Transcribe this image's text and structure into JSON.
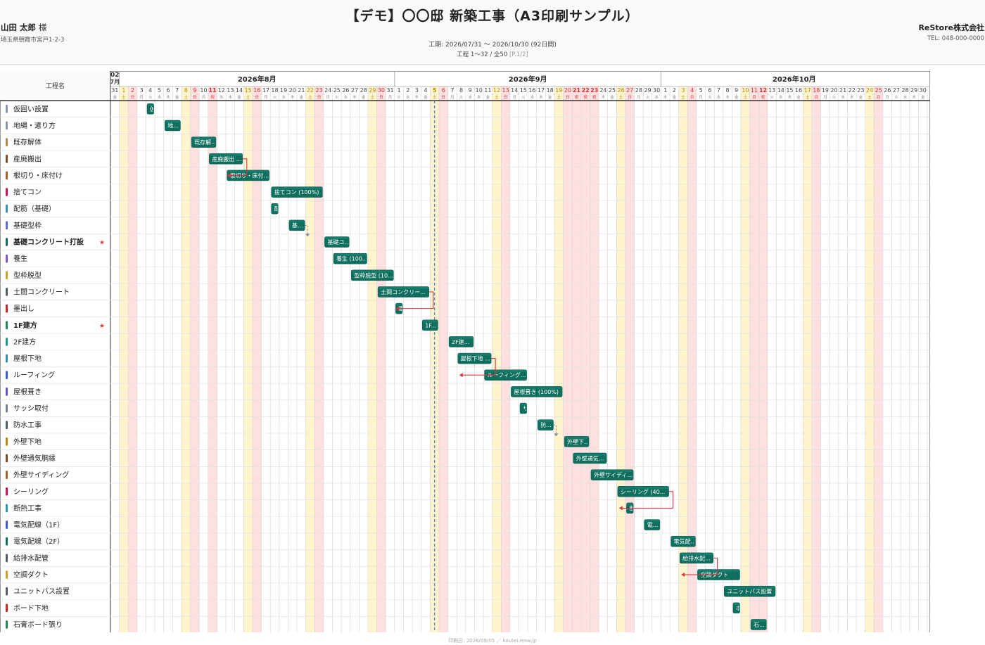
{
  "header": {
    "title": "【デモ】〇〇邸 新築工事（A3印刷サンプル）",
    "client_name": "山田 太郎",
    "client_suffix": "様",
    "client_address": "埼玉県朝霞市宮戸1-2-3",
    "company": "ReStore株式会社",
    "tel": "TEL: 048-000-0000",
    "period": "工期: 2026/07/31 〜 2026/10/30 (92日間)",
    "range": "工程 1〜32 / 全50",
    "page": "[P.1/2]"
  },
  "gantt": {
    "column_header": "工程名",
    "start_date": "2026-07-31",
    "days": 92,
    "today": "2026-09-05",
    "colors": {
      "bar": "#0f6e5e",
      "bar_light": "#1c8a77",
      "saturday": "#fff4cc",
      "holiday": "#ffe0e0",
      "today": "#4a7fd9",
      "link": "#d9363e"
    },
    "months": [
      {
        "label": "2026年8月"
      },
      {
        "label": "2026年9月"
      },
      {
        "label": "2026年10月"
      }
    ],
    "partial_month_label": "2026年7月",
    "holidays": [
      "2026-08-11",
      "2026-09-21",
      "2026-09-22",
      "2026-09-23",
      "2026-10-12"
    ],
    "weekday_labels": [
      "日",
      "月",
      "火",
      "水",
      "木",
      "金",
      "土"
    ],
    "tasks": [
      {
        "name": "仮囲い設置",
        "color": "#8a94a6",
        "bar": "仮",
        "start": 4,
        "dur": 1
      },
      {
        "name": "地縄・遣り方",
        "color": "#8a94a6",
        "bar": "地...",
        "start": 6,
        "dur": 2
      },
      {
        "name": "既存解体",
        "color": "#b08a4a",
        "bar": "既存解...",
        "start": 9,
        "dur": 3
      },
      {
        "name": "産廃搬出",
        "color": "#7a4a2a",
        "bar": "産廃搬出 ...",
        "start": 11,
        "dur": 4
      },
      {
        "name": "根切り・床付け",
        "color": "#a0602a",
        "bar": "根切り・床付...",
        "start": 13,
        "dur": 5
      },
      {
        "name": "捨てコン",
        "color": "#c2185b",
        "bar": "捨てコン (100%)",
        "start": 18,
        "dur": 6
      },
      {
        "name": "配筋（基礎）",
        "color": "#3a8fb7",
        "bar": "配",
        "start": 18,
        "dur": 1
      },
      {
        "name": "基礎型枠",
        "color": "#5b6bd6",
        "bar": "基...",
        "start": 20,
        "dur": 2
      },
      {
        "name": "基礎コンクリート打設",
        "color": "#0f6e5e",
        "bar": "基礎コ...",
        "start": 24,
        "dur": 3,
        "bold": true,
        "star": true
      },
      {
        "name": "養生",
        "color": "#7e57c2",
        "bar": "養生 (100...",
        "start": 25,
        "dur": 4
      },
      {
        "name": "型枠脱型",
        "color": "#c9a227",
        "bar": "型枠脱型 (10...",
        "start": 27,
        "dur": 5
      },
      {
        "name": "土間コンクリート",
        "color": "#555b66",
        "bar": "土間コンクリー...",
        "start": 30,
        "dur": 6
      },
      {
        "name": "墨出し",
        "color": "#c62828",
        "bar": "墨",
        "start": 32,
        "dur": 1
      },
      {
        "name": "1F建方",
        "color": "#1b8a5a",
        "bar": "1F...",
        "start": 35,
        "dur": 2,
        "bold": true,
        "star": true
      },
      {
        "name": "2F建方",
        "color": "#1f9a8a",
        "bar": "2F建...",
        "start": 38,
        "dur": 3
      },
      {
        "name": "屋根下地",
        "color": "#2a8fb0",
        "bar": "屋根下地 ...",
        "start": 39,
        "dur": 4
      },
      {
        "name": "ルーフィング",
        "color": "#3b5fd0",
        "bar": "ルーフィング...",
        "start": 42,
        "dur": 5
      },
      {
        "name": "屋根葺き",
        "color": "#6a4fd0",
        "bar": "屋根葺き (100%)",
        "start": 45,
        "dur": 6
      },
      {
        "name": "サッシ取付",
        "color": "#7a8090",
        "bar": "サ",
        "start": 46,
        "dur": 1
      },
      {
        "name": "防水工事",
        "color": "#555b66",
        "bar": "防...",
        "start": 48,
        "dur": 2
      },
      {
        "name": "外壁下地",
        "color": "#b8860b",
        "bar": "外壁下...",
        "start": 51,
        "dur": 3
      },
      {
        "name": "外壁通気胴縁",
        "color": "#7a4a2a",
        "bar": "外壁通気...",
        "start": 52,
        "dur": 4
      },
      {
        "name": "外壁サイディング",
        "color": "#a0602a",
        "bar": "外壁サイディ...",
        "start": 54,
        "dur": 5
      },
      {
        "name": "シーリング",
        "color": "#c2185b",
        "bar": "シーリング (40...",
        "start": 57,
        "dur": 6
      },
      {
        "name": "断熱工事",
        "color": "#2a9ab0",
        "bar": "断",
        "start": 58,
        "dur": 1
      },
      {
        "name": "電気配線（1F）",
        "color": "#3b5fd0",
        "bar": "電...",
        "start": 60,
        "dur": 2
      },
      {
        "name": "電気配線（2F）",
        "color": "#0f6e5e",
        "bar": "電気配...",
        "start": 63,
        "dur": 3
      },
      {
        "name": "給排水配管",
        "color": "#555b66",
        "bar": "給排水配...",
        "start": 64,
        "dur": 4
      },
      {
        "name": "空調ダクト",
        "color": "#c9a227",
        "bar": "空調ダクト",
        "start": 66,
        "dur": 5
      },
      {
        "name": "ユニットバス設置",
        "color": "#555b66",
        "bar": "ユニットバス設置",
        "start": 69,
        "dur": 6
      },
      {
        "name": "ボード下地",
        "color": "#c62828",
        "bar": "ボ",
        "start": 70,
        "dur": 1
      },
      {
        "name": "石膏ボード張り",
        "color": "#1b8a5a",
        "bar": "石...",
        "start": 72,
        "dur": 2
      }
    ],
    "links": [
      {
        "from": 3,
        "to": 4,
        "kind": "red"
      },
      {
        "from": 7,
        "to": 8,
        "kind": "dash"
      },
      {
        "from": 11,
        "to": 12,
        "kind": "red"
      },
      {
        "from": 15,
        "to": 15,
        "kind": "red"
      },
      {
        "from": 19,
        "to": 20,
        "kind": "dash"
      },
      {
        "from": 23,
        "to": 23,
        "kind": "red"
      },
      {
        "from": 27,
        "to": 27,
        "kind": "red"
      }
    ]
  },
  "footer": {
    "printed": "印刷日: 2026/09/05 ／ koutei.resw.jp"
  }
}
